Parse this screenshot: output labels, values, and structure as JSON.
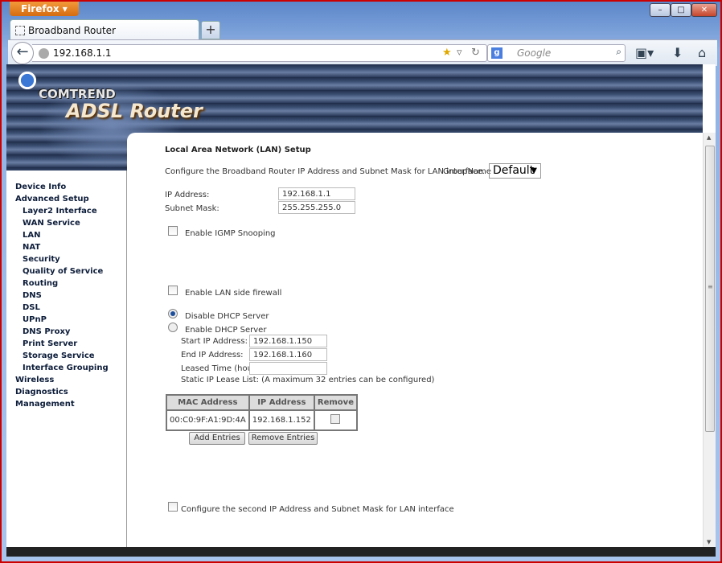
{
  "browser": {
    "app_button": "Firefox",
    "tab_title": "Broadband Router",
    "new_tab": "+",
    "url": "192.168.1.1",
    "search_placeholder": "Google",
    "search_engine": "g",
    "window_controls": [
      "–",
      "□",
      "✕"
    ]
  },
  "banner": {
    "brand": "COMTREND",
    "product": "ADSL Router"
  },
  "sidebar": {
    "items": [
      {
        "label": "Device Info",
        "sub": false
      },
      {
        "label": "Advanced Setup",
        "sub": false
      },
      {
        "label": "Layer2 Interface",
        "sub": true
      },
      {
        "label": "WAN Service",
        "sub": true
      },
      {
        "label": "LAN",
        "sub": true
      },
      {
        "label": "NAT",
        "sub": true
      },
      {
        "label": "Security",
        "sub": true
      },
      {
        "label": "Quality of Service",
        "sub": true
      },
      {
        "label": "Routing",
        "sub": true
      },
      {
        "label": "DNS",
        "sub": true
      },
      {
        "label": "DSL",
        "sub": true
      },
      {
        "label": "UPnP",
        "sub": true
      },
      {
        "label": "DNS Proxy",
        "sub": true
      },
      {
        "label": "Print Server",
        "sub": true
      },
      {
        "label": "Storage Service",
        "sub": true
      },
      {
        "label": "Interface Grouping",
        "sub": true
      },
      {
        "label": "Wireless",
        "sub": false
      },
      {
        "label": "Diagnostics",
        "sub": false
      },
      {
        "label": "Management",
        "sub": false
      }
    ]
  },
  "main": {
    "title": "Local Area Network (LAN) Setup",
    "description": "Configure the Broadband Router IP Address and Subnet Mask for LAN interface.",
    "group_label": "GroupName",
    "group_value": "Default",
    "ip_label": "IP Address:",
    "ip_value": "192.168.1.1",
    "mask_label": "Subnet Mask:",
    "mask_value": "255.255.255.0",
    "igmp_label": "Enable IGMP Snooping",
    "igmp_checked": false,
    "firewall_label": "Enable LAN side firewall",
    "firewall_checked": false,
    "dhcp_disable_label": "Disable DHCP Server",
    "dhcp_enable_label": "Enable DHCP Server",
    "dhcp_selected": "disable",
    "start_label": "Start IP Address:",
    "start_value": "192.168.1.150",
    "end_label": "End IP Address:",
    "end_value": "192.168.1.160",
    "lease_label": "Leased Time (hour):",
    "lease_value": "",
    "static_note": "Static IP Lease List: (A maximum 32 entries can be configured)",
    "table": {
      "headers": [
        "MAC Address",
        "IP Address",
        "Remove"
      ],
      "rows": [
        {
          "mac": "00:C0:9F:A1:9D:4A",
          "ip": "192.168.1.152",
          "remove": false
        }
      ]
    },
    "add_button": "Add Entries",
    "remove_button": "Remove Entries",
    "second_ip_label": "Configure the second IP Address and Subnet Mask for LAN interface",
    "second_ip_checked": false
  }
}
